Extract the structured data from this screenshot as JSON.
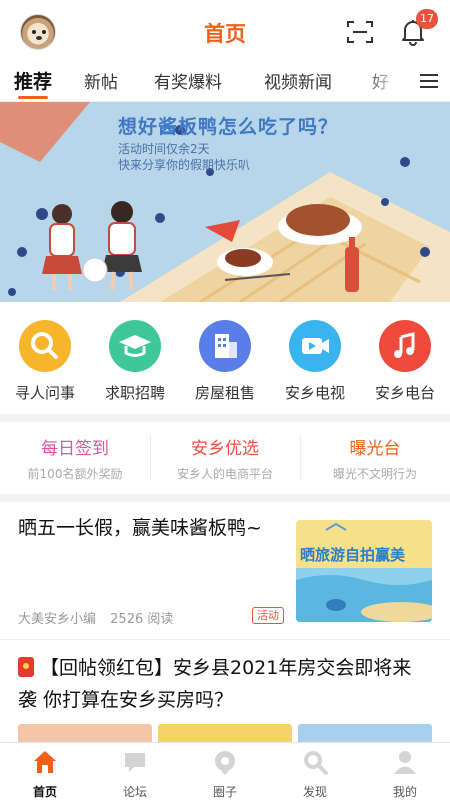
{
  "header": {
    "title": "首页",
    "notification_count": "17"
  },
  "tabs": [
    "推荐",
    "新帖",
    "有奖爆料",
    "视频新闻",
    "好"
  ],
  "banner": {
    "title": "想好酱板鸭怎么吃了吗？",
    "line1": "活动时间仅余2天",
    "line2": "快来分享你的假期快乐叭"
  },
  "quick_links": [
    {
      "label": "寻人问事",
      "icon": "search-icon",
      "color": "#f7b52c"
    },
    {
      "label": "求职招聘",
      "icon": "graduation-cap-icon",
      "color": "#3fc79a"
    },
    {
      "label": "房屋租售",
      "icon": "building-icon",
      "color": "#5a7ee8"
    },
    {
      "label": "安乡电视",
      "icon": "video-camera-icon",
      "color": "#3ab4ef"
    },
    {
      "label": "安乡电台",
      "icon": "music-note-icon",
      "color": "#ef4a3b"
    }
  ],
  "features": [
    {
      "title": "每日签到",
      "subtitle": "前100名额外奖励",
      "color": "#e0539d"
    },
    {
      "title": "安乡优选",
      "subtitle": "安乡人的电商平台",
      "color": "#e8523f"
    },
    {
      "title": "曝光台",
      "subtitle": "曝光不文明行为",
      "color": "#f0601a"
    }
  ],
  "article1": {
    "title": "晒五一长假，赢美味酱板鸭~",
    "author": "大美安乡小编",
    "reads": "2526 阅读",
    "tag": "活动",
    "thumb_text": "晒旅游自拍赢美"
  },
  "article2": {
    "title": "【回帖领红包】安乡县2021年房交会即将来袭 你打算在安乡买房吗？"
  },
  "bottom_nav": [
    {
      "label": "首页",
      "icon": "home-icon",
      "active": true
    },
    {
      "label": "论坛",
      "icon": "chat-icon",
      "active": false
    },
    {
      "label": "圈子",
      "icon": "circle-icon",
      "active": false
    },
    {
      "label": "发现",
      "icon": "discover-icon",
      "active": false
    },
    {
      "label": "我的",
      "icon": "user-icon",
      "active": false
    }
  ],
  "colors": {
    "accent": "#f0601a",
    "badge": "#e8523f"
  }
}
